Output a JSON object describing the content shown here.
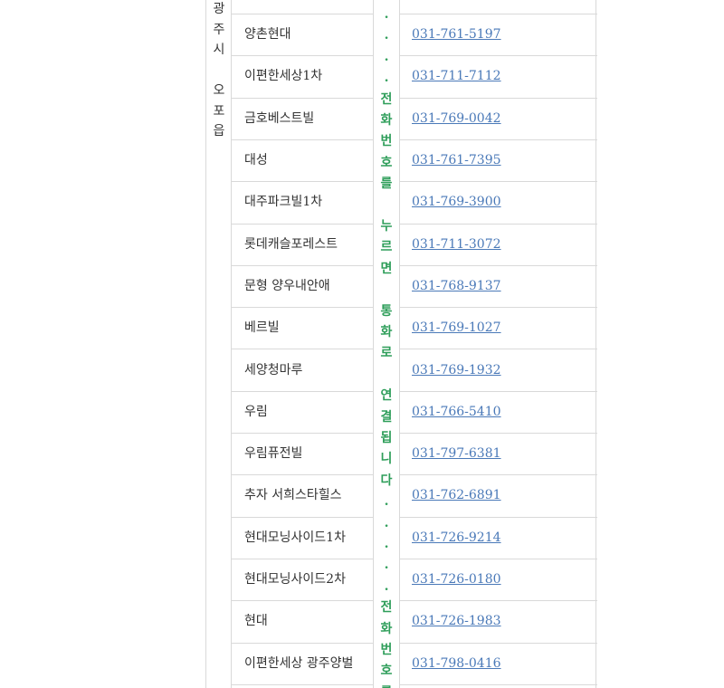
{
  "region_label": [
    "광",
    "주",
    "시",
    "",
    "오",
    "포",
    "읍"
  ],
  "accent_color": "#2f9e5a",
  "link_color": "#4a79b8",
  "notice_chars": [
    ".",
    ".",
    ".",
    ".",
    "전",
    "화",
    "번",
    "호",
    "를",
    "",
    "누",
    "르",
    "면",
    "",
    "통",
    "화",
    "로",
    "",
    "연",
    "결",
    "됩",
    "니",
    "다",
    ".",
    ".",
    ".",
    ".",
    ".",
    "전",
    "화",
    "번",
    "호",
    "를"
  ],
  "rows": [
    {
      "name": "양촌현대",
      "phone": "031-761-5197"
    },
    {
      "name": "이편한세상1차",
      "phone": "031-711-7112"
    },
    {
      "name": "금호베스트빌",
      "phone": "031-769-0042"
    },
    {
      "name": "대성",
      "phone": "031-761-7395"
    },
    {
      "name": "대주파크빌1차",
      "phone": "031-769-3900"
    },
    {
      "name": "롯데캐슬포레스트",
      "phone": "031-711-3072"
    },
    {
      "name": "문형 양우내안애",
      "phone": "031-768-9137"
    },
    {
      "name": "베르빌",
      "phone": "031-769-1027"
    },
    {
      "name": "세양청마루",
      "phone": "031-769-1932"
    },
    {
      "name": "우림",
      "phone": "031-766-5410"
    },
    {
      "name": "우림퓨전빌",
      "phone": "031-797-6381"
    },
    {
      "name": "추자 서희스타힐스",
      "phone": "031-762-6891"
    },
    {
      "name": "현대모닝사이드1차",
      "phone": "031-726-9214"
    },
    {
      "name": "현대모닝사이드2차",
      "phone": "031-726-0180"
    },
    {
      "name": "현대",
      "phone": "031-726-1983"
    },
    {
      "name": "이편한세상 광주양벌",
      "phone": "031-798-0416"
    }
  ]
}
